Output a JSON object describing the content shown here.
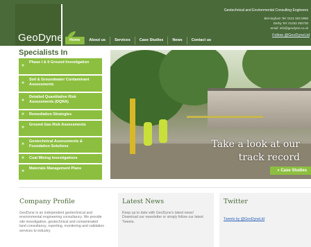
{
  "header": {
    "logo": "GeoDyne",
    "tagline": "Geotechnical and Environmental Consulting Engineers",
    "contact_lines": [
      "Birmingham Tel: 0121 503 0900",
      "Derby Tel: 01332 292730",
      "email: info@geodyne.co.uk"
    ],
    "twitter_link": "Follow @GeoDyneLtd"
  },
  "nav": {
    "items": [
      "Home",
      "About us",
      "Services",
      "Case Studies",
      "News",
      "Contact us"
    ],
    "active_index": 0
  },
  "sidebar": {
    "title": "Specialists In",
    "items": [
      "Phase I & II Ground Investigation",
      "Soil & Groundwater Contaminant Assessments",
      "Detailed Quantitative Risk Assessments (DQRA)",
      "Remediation Strategies",
      "Ground Gas Risk Assessments",
      "Geotechnical Assessments & Foundation Solutions",
      "Coal Mining Investigations",
      "Materials Management Plans"
    ]
  },
  "hero": {
    "caption_line1": "Take a look at our",
    "caption_line2": "track record",
    "button": "Case Studies"
  },
  "columns": {
    "profile": {
      "title": "Company Profile",
      "text": "GeoDyne is an independent geotechnical and environmental engineering consultancy. We provide site investigation, geotechnical and contaminated land consultancy, reporting, monitoring and validation services to industry."
    },
    "news": {
      "title": "Latest News",
      "text": "Keep up to date with GeoDyne's latest news! Download our newsletter or simply follow our latest Tweets."
    },
    "twitter": {
      "title": "Twitter",
      "link": "Tweets by @GeoDyneLtd"
    }
  },
  "colors": {
    "header_green": "#4a6a3a",
    "accent_green": "#8cbf3f"
  }
}
